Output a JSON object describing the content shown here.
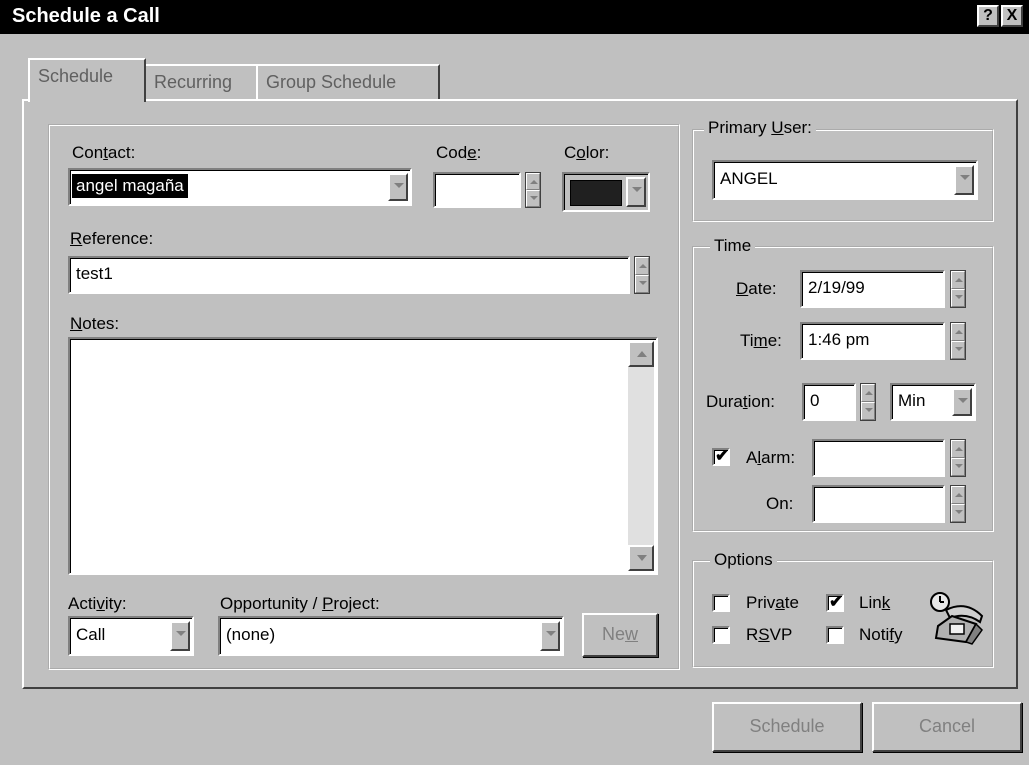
{
  "window": {
    "title": "Schedule a Call",
    "help_btn": "?",
    "close_btn": "X"
  },
  "tabs": [
    {
      "label": "Schedule",
      "active": true
    },
    {
      "label": "Recurring",
      "active": false
    },
    {
      "label": "Group Schedule",
      "active": false
    }
  ],
  "contact": {
    "label_pre": "Con",
    "label_u": "t",
    "label_post": "act:",
    "value": "angel magaña"
  },
  "code": {
    "label_pre": "Cod",
    "label_u": "e",
    "label_post": ":",
    "value": ""
  },
  "color": {
    "label_pre": "C",
    "label_u": "o",
    "label_post": "lor:",
    "swatch": "#202020"
  },
  "reference": {
    "label_u": "R",
    "label_post": "eference:",
    "value": "test1"
  },
  "notes": {
    "label_u": "N",
    "label_post": "otes:",
    "value": ""
  },
  "activity": {
    "label_pre": "Acti",
    "label_u": "v",
    "label_post": "ity:",
    "value": "Call"
  },
  "opportunity": {
    "label_pre": "Opportunity / ",
    "label_u": "P",
    "label_post": "roject:",
    "value": "(none)"
  },
  "new_button": {
    "pre": "Ne",
    "u": "w"
  },
  "primary_user": {
    "label_pre": "Primary ",
    "label_u": "U",
    "label_post": "ser:",
    "value": "ANGEL"
  },
  "time_group": {
    "title": "Time",
    "date": {
      "label_u": "D",
      "label_post": "ate:",
      "value": "2/19/99"
    },
    "time": {
      "label_pre": "Ti",
      "label_u": "m",
      "label_post": "e:",
      "value": "1:46 pm"
    },
    "duration": {
      "label_pre": "Dura",
      "label_u": "t",
      "label_post": "ion:",
      "value": "0",
      "unit": "Min"
    },
    "alarm": {
      "label_pre": "A",
      "label_u": "l",
      "label_post": "arm:",
      "checked": true,
      "value": ""
    },
    "on": {
      "label": "On:",
      "value": ""
    }
  },
  "options_group": {
    "title": "Options",
    "private": {
      "pre": "Priv",
      "u": "a",
      "post": "te",
      "checked": false
    },
    "link": {
      "pre": "Lin",
      "u": "k",
      "post": "",
      "checked": true
    },
    "rsvp": {
      "pre": "R",
      "u": "S",
      "post": "VP",
      "checked": false
    },
    "notify": {
      "pre": "Noti",
      "u": "f",
      "post": "y",
      "checked": false
    }
  },
  "buttons": {
    "schedule": "Schedule",
    "cancel": "Cancel"
  }
}
